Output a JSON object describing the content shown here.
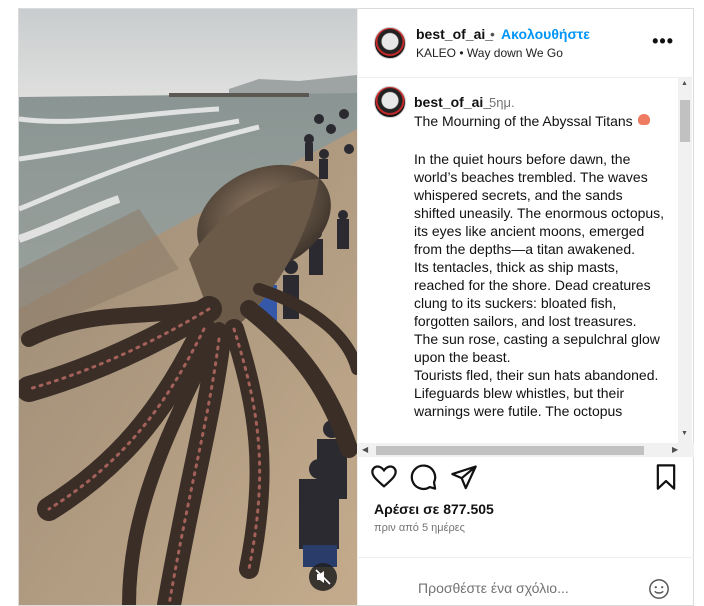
{
  "post": {
    "username": "best_of_ai_",
    "separator": "•",
    "follow_label": "Ακολουθήστε",
    "audio": "KALEO • Way down We Go",
    "more_label": "•••"
  },
  "caption": {
    "username": "best_of_ai_",
    "time": "5ημ.",
    "title": "The Mourning of the Abyssal Titans",
    "title_emoji": "octopus",
    "body": "In the quiet hours before dawn, the world’s beaches trembled. The waves whispered secrets, and the sands shifted uneasily. The enormous octopus, its eyes like ancient moons, emerged from the depths—a titan awakened.\nIts tentacles, thick as ship masts, reached for the shore. Dead creatures clung to its suckers: bloated fish, forgotten sailors, and lost treasures.\nThe sun rose, casting a sepulchral glow upon the beast.\nTourists fled, their sun hats abandoned. Lifeguards blew whistles, but their warnings were futile. The octopus"
  },
  "actions": {
    "like_icon": "heart-icon",
    "comment_icon": "comment-icon",
    "share_icon": "paper-plane-icon",
    "save_icon": "bookmark-icon"
  },
  "likes_label": "Αρέσει σε 877.505",
  "time_ago": "πριν από 5 ημέρες",
  "comment_placeholder": "Προσθέστε ένα σχόλιο...",
  "media": {
    "mute_icon": "speaker-muted-icon"
  },
  "colors": {
    "link": "#0095f6",
    "muted_text": "#737373",
    "border": "#dbdbdb"
  }
}
